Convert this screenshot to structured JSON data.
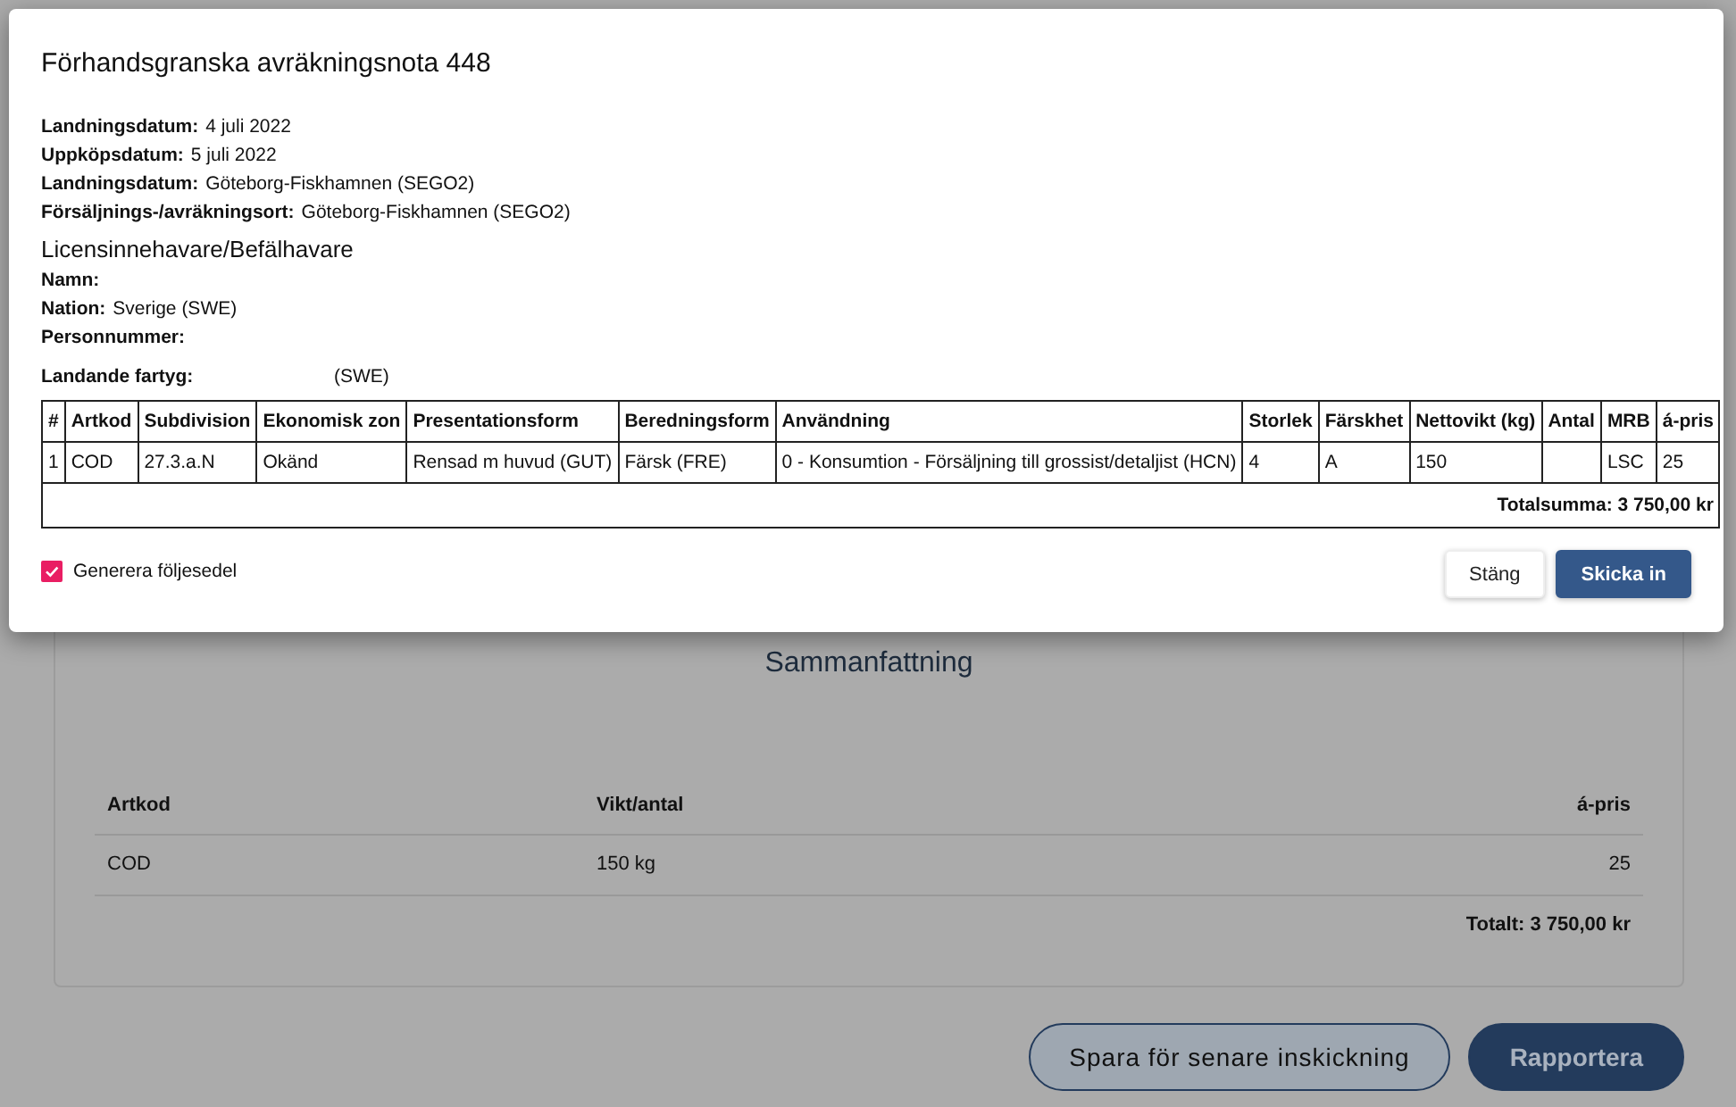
{
  "background": {
    "summary": {
      "title": "Sammanfattning",
      "columns": [
        "Artkod",
        "Vikt/antal",
        "á-pris"
      ],
      "rows": [
        [
          "COD",
          "150 kg",
          "25"
        ]
      ],
      "total": "Totalt: 3 750,00 kr"
    },
    "buttons": [
      {
        "label": "Spara för senare inskickning",
        "kind": "outline"
      },
      {
        "label": "Rapportera",
        "kind": "primary"
      }
    ]
  },
  "dialog": {
    "title": "Förhandsgranska avräkningsnota 448",
    "details": [
      {
        "label": "Landningsdatum:",
        "value": "4 juli 2022"
      },
      {
        "label": "Uppköpsdatum:",
        "value": "5 juli 2022"
      },
      {
        "label": "Landningsdatum:",
        "value": "Göteborg-Fiskhamnen (SEGO2)"
      },
      {
        "label": "Försäljnings-/avräkningsort:",
        "value": "Göteborg-Fiskhamnen (SEGO2)"
      }
    ],
    "holder_heading": "Licensinnehavare/Befälhavare",
    "holder": [
      {
        "label": "Namn:"
      },
      {
        "label": "Nation:",
        "value": "Sverige (SWE)"
      },
      {
        "label": "Personnummer:"
      }
    ],
    "vessel": {
      "label": "Landande fartyg:",
      "value": "(SWE)"
    },
    "table": {
      "columns": [
        "#",
        "Artkod",
        "Subdivision",
        "Ekonomisk zon",
        "Presentationsform",
        "Beredningsform",
        "Användning",
        "Storlek",
        "Färskhet",
        "Nettovikt (kg)",
        "Antal",
        "MRB",
        "á-pris"
      ],
      "rows": [
        [
          "1",
          "COD",
          "27.3.a.N",
          "Okänd",
          "Rensad m huvud (GUT)",
          "Färsk (FRE)",
          "0 - Konsumtion - Försäljning till grossist/detaljist (HCN)",
          "4",
          "A",
          "150",
          "",
          "LSC",
          "25"
        ]
      ],
      "total": "Totalsumma: 3 750,00 kr"
    },
    "checkbox": {
      "label": "Generera följesedel",
      "checked": true
    },
    "buttons": [
      {
        "label": "Stäng",
        "kind": "secondary"
      },
      {
        "label": "Skicka in",
        "kind": "primary"
      }
    ]
  }
}
